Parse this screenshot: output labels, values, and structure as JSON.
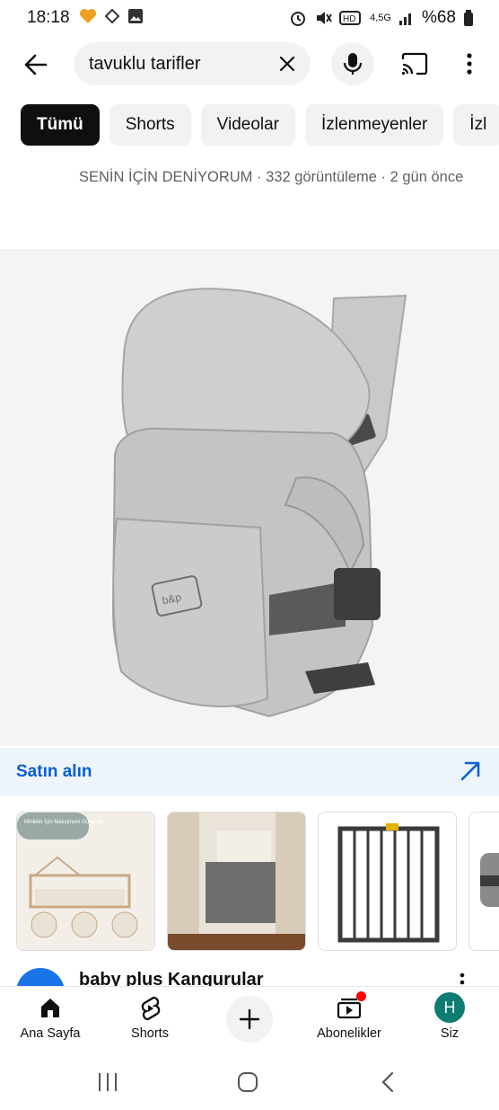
{
  "status_bar": {
    "time": "18:18",
    "network": "4,5G",
    "battery": "%68"
  },
  "search": {
    "query": "tavuklu tarifler"
  },
  "chips": [
    {
      "label": "Tümü",
      "active": true
    },
    {
      "label": "Shorts",
      "active": false
    },
    {
      "label": "Videolar",
      "active": false
    },
    {
      "label": "İzlenmeyenler",
      "active": false
    },
    {
      "label": "İzl",
      "active": false
    }
  ],
  "previous_video": {
    "meta": "SENİN İÇİN DENİYORUM · 332 görüntüleme · 2 gün önce"
  },
  "product": {
    "brand_logo": "baby & plus",
    "buy_label": "Satın alın"
  },
  "thumbnails": [
    {
      "name": "thumb-safety-bed",
      "headline": "Minikler İçin Maksimum Güvenlik"
    },
    {
      "name": "thumb-hallway-gate"
    },
    {
      "name": "thumb-metal-gate"
    },
    {
      "name": "thumb-bag-partial"
    }
  ],
  "next_result": {
    "title": "baby plus Kangurular"
  },
  "bottom_nav": {
    "home": "Ana Sayfa",
    "shorts": "Shorts",
    "subscriptions": "Abonelikler",
    "you": "Siz",
    "avatar_letter": "H"
  },
  "colors": {
    "accent_link": "#065fd4",
    "avatar": "#0e7c72",
    "notification_dot": "#ff0000"
  }
}
